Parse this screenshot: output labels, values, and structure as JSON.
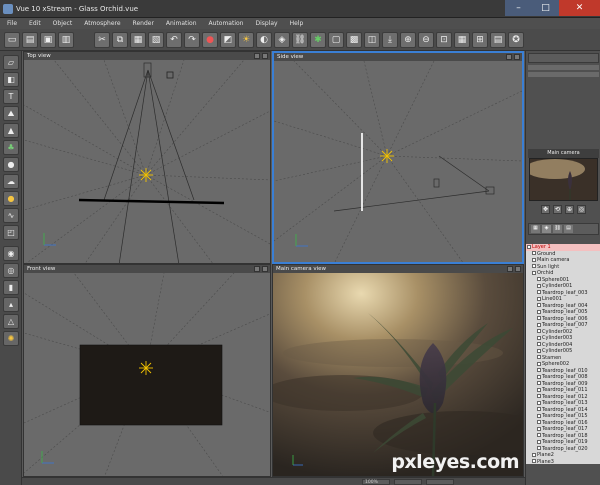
{
  "window": {
    "title": "Vue 10 xStream - Glass Orchid.vue"
  },
  "menu": [
    "File",
    "Edit",
    "Object",
    "Atmosphere",
    "Render",
    "Animation",
    "Automation",
    "Display",
    "Help"
  ],
  "viewports": {
    "top": {
      "title": "Top view"
    },
    "side": {
      "title": "Side view"
    },
    "front": {
      "title": "Front view"
    },
    "camera": {
      "title": "Main camera view"
    }
  },
  "right_panel": {
    "preview_title": "Main camera"
  },
  "world_tree": [
    {
      "label": "Layer 1",
      "selected": true
    },
    {
      "label": "Ground"
    },
    {
      "label": "Main camera"
    },
    {
      "label": "Sun light"
    },
    {
      "label": "Orchid"
    },
    {
      "label": "Sphere001"
    },
    {
      "label": "Cylinder001"
    },
    {
      "label": "Teardrop_leaf_003"
    },
    {
      "label": "Line001"
    },
    {
      "label": "Teardrop_leaf_004"
    },
    {
      "label": "Teardrop_leaf_005"
    },
    {
      "label": "Teardrop_leaf_006"
    },
    {
      "label": "Teardrop_leaf_007"
    },
    {
      "label": "Cylinder002"
    },
    {
      "label": "Cylinder003"
    },
    {
      "label": "Cylinder004"
    },
    {
      "label": "Cylinder005"
    },
    {
      "label": "Stamen"
    },
    {
      "label": "Sphere002"
    },
    {
      "label": "Teardrop_leaf_010"
    },
    {
      "label": "Teardrop_leaf_008"
    },
    {
      "label": "Teardrop_leaf_009"
    },
    {
      "label": "Teardrop_leaf_011"
    },
    {
      "label": "Teardrop_leaf_012"
    },
    {
      "label": "Teardrop_leaf_013"
    },
    {
      "label": "Teardrop_leaf_014"
    },
    {
      "label": "Teardrop_leaf_015"
    },
    {
      "label": "Teardrop_leaf_016"
    },
    {
      "label": "Teardrop_leaf_017"
    },
    {
      "label": "Teardrop_leaf_018"
    },
    {
      "label": "Teardrop_leaf_019"
    },
    {
      "label": "Teardrop_leaf_020"
    },
    {
      "label": "Plane2"
    },
    {
      "label": "Plane3"
    }
  ],
  "status": {
    "zoom": "100%"
  },
  "watermark": "pxleyes.com",
  "colors": {
    "active_viewport": "#3a7fd5",
    "selected_layer": "#b00000"
  }
}
